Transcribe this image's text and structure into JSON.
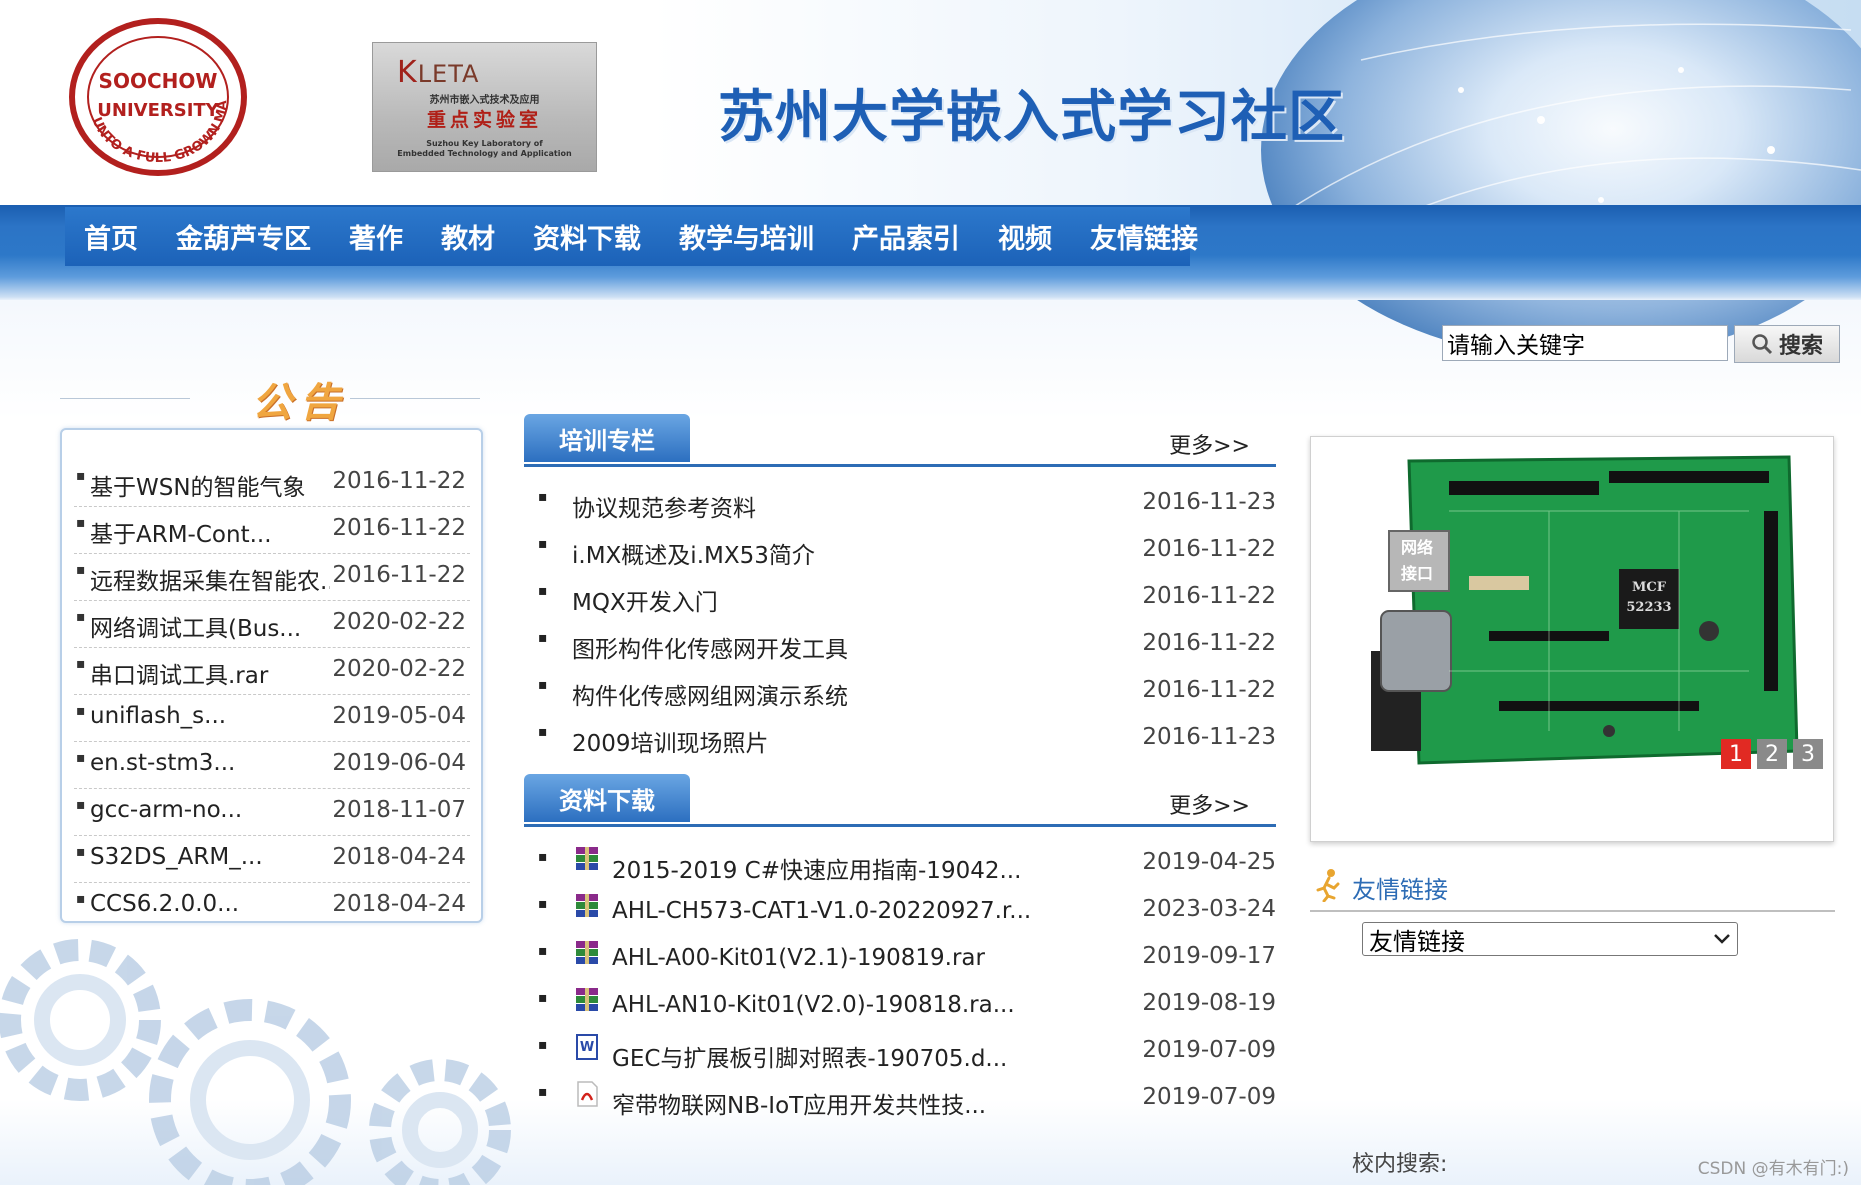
{
  "header": {
    "site_title": "苏州大学嵌入式学习社区",
    "kleta": {
      "name_lead": "K",
      "name_rest": "LETA",
      "line1": "苏州市嵌入式技术及应用",
      "line2": "重点实验室",
      "line3a": "Suzhou Key Laboratory of",
      "line3b": "Embedded Technology and Application"
    },
    "university_logo_text": "SOOCHOW UNIVERSITY · UNTO A FULL GROWN MAN"
  },
  "nav": {
    "items": [
      "首页",
      "金葫芦专区",
      "著作",
      "教材",
      "资料下载",
      "教学与培训",
      "产品索引",
      "视频",
      "友情链接"
    ]
  },
  "search": {
    "placeholder": "请输入关键字",
    "button_label": "搜索"
  },
  "notice": {
    "title": "公告",
    "items": [
      {
        "title": "基于WSN的智能气象",
        "date": "2016-11-22"
      },
      {
        "title": "基于ARM-Cont...",
        "date": "2016-11-22"
      },
      {
        "title": "远程数据采集在智能农...",
        "date": "2016-11-22"
      },
      {
        "title": "网络调试工具(Bus...",
        "date": "2020-02-22"
      },
      {
        "title": "串口调试工具.rar",
        "date": "2020-02-22"
      },
      {
        "title": "uniflash_s...",
        "date": "2019-05-04"
      },
      {
        "title": "en.st-stm3...",
        "date": "2019-06-04"
      },
      {
        "title": "gcc-arm-no...",
        "date": "2018-11-07"
      },
      {
        "title": "S32DS_ARM_...",
        "date": "2018-04-24"
      },
      {
        "title": "CCS6.2.0.0...",
        "date": "2018-04-24"
      }
    ]
  },
  "training": {
    "tab_label": "培训专栏",
    "more": "更多>>",
    "items": [
      {
        "title": "协议规范参考资料",
        "date": "2016-11-23"
      },
      {
        "title": "i.MX概述及i.MX53简介",
        "date": "2016-11-22"
      },
      {
        "title": "MQX开发入门",
        "date": "2016-11-22"
      },
      {
        "title": "图形构件化传感网开发工具",
        "date": "2016-11-22"
      },
      {
        "title": "构件化传感网组网演示系统",
        "date": "2016-11-22"
      },
      {
        "title": "2009培训现场照片",
        "date": "2016-11-23"
      }
    ]
  },
  "downloads": {
    "tab_label": "资料下载",
    "more": "更多>>",
    "items": [
      {
        "icon": "rar-archive-icon",
        "title": "2015-2019 C#快速应用指南-19042...",
        "date": "2019-04-25"
      },
      {
        "icon": "rar-archive-icon",
        "title": "AHL-CH573-CAT1-V1.0-20220927.r...",
        "date": "2023-03-24"
      },
      {
        "icon": "rar-archive-icon",
        "title": "AHL-A00-Kit01(V2.1)-190819.rar",
        "date": "2019-09-17"
      },
      {
        "icon": "rar-archive-icon",
        "title": "AHL-AN10-Kit01(V2.0)-190818.ra...",
        "date": "2019-08-19"
      },
      {
        "icon": "word-doc-icon",
        "title": "GEC与扩展板引脚对照表-190705.d...",
        "date": "2019-07-09"
      },
      {
        "icon": "pdf-file-icon",
        "title": "窄带物联网NB-IoT应用开发共性技...",
        "date": "2019-07-09"
      }
    ]
  },
  "slideshow": {
    "board_labels": [
      "网络",
      "接口",
      "MCF",
      "52233"
    ],
    "pages": [
      "1",
      "2",
      "3"
    ],
    "active_page": "1"
  },
  "links": {
    "title": "友情链接",
    "select_value": "友情链接"
  },
  "footer": {
    "site_search_label": "校内搜索:",
    "watermark": "CSDN @有木有门:)"
  },
  "colors": {
    "brand_blue": "#1e5fb5",
    "nav_blue": "#2c74c6",
    "notice_orange": "#f0a640",
    "active_page_red": "#e12a23"
  }
}
